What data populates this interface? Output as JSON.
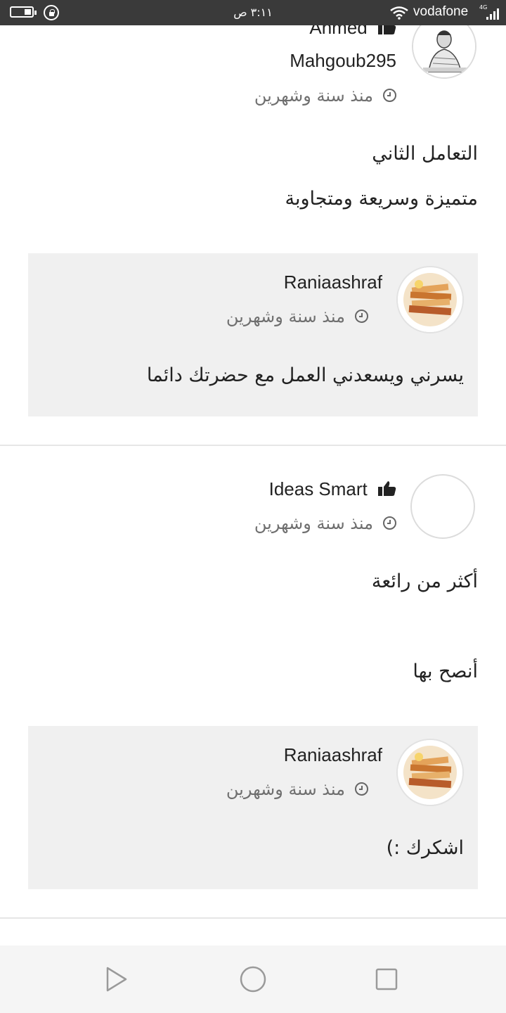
{
  "status_bar": {
    "time": "٣:١١ ص",
    "carrier": "vodafone",
    "network": "4G"
  },
  "comments": [
    {
      "author_line1": "Ahmed",
      "author_line2": "Mahgoub295",
      "time_ago": "منذ سنة وشهرين",
      "body": [
        "التعامل الثاني",
        "متميزة وسريعة ومتجاوبة"
      ],
      "reply": {
        "author": "Raniaashraf",
        "time_ago": "منذ سنة وشهرين",
        "body": "يسرني ويسعدني العمل مع حضرتك دائما"
      }
    },
    {
      "author": "Ideas Smart",
      "time_ago": "منذ سنة وشهرين",
      "body": [
        "أكثر من رائعة",
        "أنصح بها"
      ],
      "reply": {
        "author": "Raniaashraf",
        "time_ago": "منذ سنة وشهرين",
        "body": "اشكرك :)"
      }
    }
  ],
  "icons": {
    "recommend": "thumbs-up-icon",
    "time": "clock-icon",
    "nav_back": "triangle-back-icon",
    "nav_home": "circle-home-icon",
    "nav_recent": "square-recents-icon"
  },
  "colors": {
    "reply_background": "#f0f0f0",
    "status_bar": "#3a3a3a",
    "muted_text": "#6f6f6f"
  }
}
